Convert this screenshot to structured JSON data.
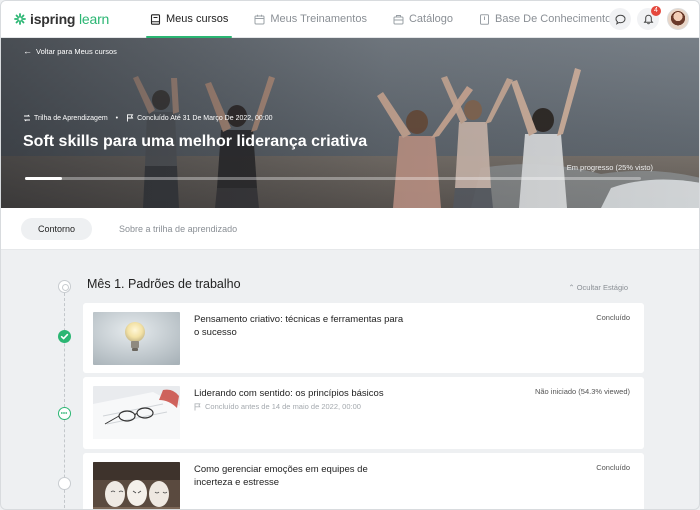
{
  "header": {
    "logo_brand": "ispring",
    "logo_product": "learn",
    "nav": [
      {
        "label": "Meus cursos",
        "icon": "course-book-icon",
        "active": true
      },
      {
        "label": "Meus Treinamentos",
        "icon": "calendar-icon",
        "active": false
      },
      {
        "label": "Catálogo",
        "icon": "catalog-briefcase-icon",
        "active": false
      },
      {
        "label": "Base De Conhecimento",
        "icon": "knowledge-book-icon",
        "active": false
      }
    ],
    "notification_count": "4"
  },
  "hero": {
    "back_label": "Voltar para Meus cursos",
    "type_label": "Trilha de Aprendizagem",
    "deadline_label": "Concluído Até 31 De Março De 2022, 00:00",
    "title": "Soft skills para uma melhor liderança criativa",
    "progress_label": "Em progresso (25% visto)",
    "progress_fraction": 0.06
  },
  "tabs": [
    {
      "label": "Contorno",
      "active": true
    },
    {
      "label": "Sobre a trilha de aprendizado",
      "active": false
    }
  ],
  "stage": {
    "title": "Mês 1. Padrões de trabalho",
    "collapse_label": "Ocultar Estágio"
  },
  "items": [
    {
      "title": "Pensamento criativo: técnicas e ferramentas para o sucesso",
      "status": "Concluído",
      "deadline": ""
    },
    {
      "title": "Liderando com sentido: os princípios básicos",
      "status": "Não iniciado (54.3% viewed)",
      "deadline": "Concluído antes de 14 de maio de 2022, 00:00"
    },
    {
      "title": "Como gerenciar emoções em equipes de incerteza e estresse",
      "status": "Concluído",
      "deadline": ""
    }
  ],
  "colors": {
    "accent": "#2bb673",
    "badge": "#e5483d"
  }
}
